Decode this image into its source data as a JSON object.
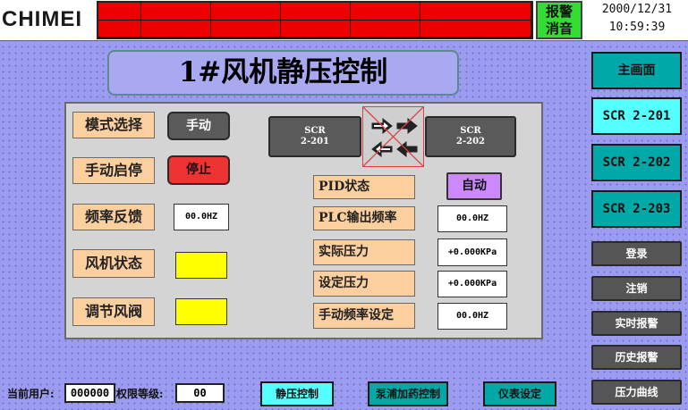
{
  "header": {
    "logo": "CHIMEI",
    "silence_line1": "报警",
    "silence_line2": "消音",
    "date": "2000/12/31",
    "time": "10:59:39"
  },
  "title": "1#风机静压控制",
  "left": {
    "mode_label": "模式选择",
    "mode_button": "手动",
    "start_label": "手动启停",
    "start_button": "停止",
    "freq_label": "频率反馈",
    "freq_value": "00.0HZ",
    "fan_label": "风机状态",
    "damper_label": "调节风阀"
  },
  "scr": {
    "left_line1": "SCR",
    "left_line2": "2-201",
    "right_line1": "SCR",
    "right_line2": "2-202"
  },
  "right": {
    "pid_label": "PID状态",
    "pid_button": "自动",
    "plc_label": "PLC输出频率",
    "plc_value": "00.0HZ",
    "actual_label": "实际压力",
    "actual_value": "+0.000KPa",
    "set_label": "设定压力",
    "set_value": "+0.000KPa",
    "manual_label": "手动频率设定",
    "manual_value": "00.0HZ"
  },
  "nav": {
    "main": "主画面",
    "scr201": "SCR 2-201",
    "scr202": "SCR 2-202",
    "scr203": "SCR 2-203",
    "login": "登录",
    "logout": "注销",
    "realtime_alarm": "实时报警",
    "history_alarm": "历史报警",
    "pressure_curve": "压力曲线"
  },
  "footer": {
    "user_label": "当前用户:",
    "user_value": "000000",
    "level_label": "权限等级:",
    "level_value": "00",
    "static_pressure": "静压控制",
    "pump_dosing": "泵浦加药控制",
    "instrument": "仪表设定"
  },
  "colors": {
    "background": "#9b9bf0",
    "alarm_red": "#ee0000",
    "silence_green": "#33dd33",
    "label_orange": "#fbcf9e",
    "nav_teal": "#00a8a8",
    "nav_active": "#55ffff",
    "indicator_yellow": "#ffff00",
    "stop_red": "#ee3333",
    "auto_purple": "#cc88ff"
  },
  "icons": {
    "transfer": "swap-arrows-icon",
    "disabled": "red-x-icon"
  }
}
